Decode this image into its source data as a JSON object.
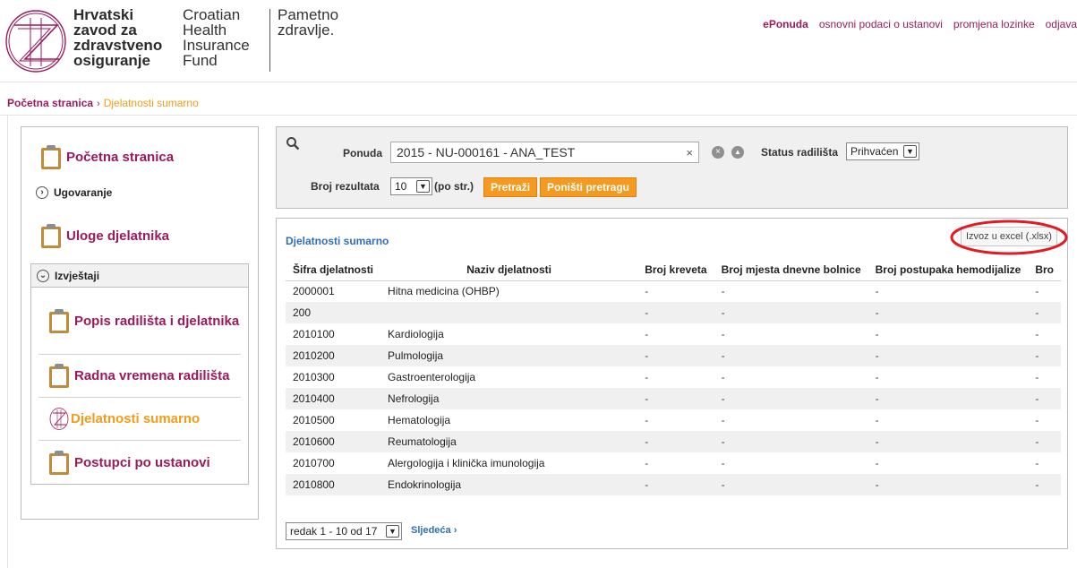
{
  "logo": {
    "hr_line1": "Hrvatski",
    "hr_line2": "zavod za",
    "hr_line3": "zdravstveno",
    "hr_line4": "osiguranje",
    "en_line1": "Croatian",
    "en_line2": "Health",
    "en_line3": "Insurance",
    "en_line4": "Fund",
    "slogan_line1": "Pametno",
    "slogan_line2": "zdravlje."
  },
  "top_nav": {
    "eponuda": "ePonuda",
    "basic_data": "osnovni podaci o ustanovi",
    "change_password": "promjena lozinke",
    "logout": "odjava"
  },
  "breadcrumb": {
    "home": "Početna stranica",
    "separator": "›",
    "current": "Djelatnosti sumarno"
  },
  "sidebar": {
    "home": "Početna stranica",
    "contracting": "Ugovaranje",
    "employee_roles": "Uloge djelatnika",
    "reports": "Izvještaji",
    "report_items": [
      "Popis radilišta i djelatnika",
      "Radna vremena radilišta",
      "Djelatnosti sumarno",
      "Postupci po ustanovi"
    ]
  },
  "search": {
    "ponuda_label": "Ponuda",
    "ponuda_value": "2015 - NU-000161 - ANA_TEST",
    "clear": "×",
    "status_label": "Status radilišta",
    "status_value": "Prihvaćen",
    "results_label": "Broj rezultata",
    "results_value": "10",
    "per_page": "(po str.)",
    "search_button": "Pretraži",
    "reset_button": "Poništi pretragu"
  },
  "results": {
    "title": "Djelatnosti sumarno",
    "export_button": "Izvoz u excel (.xlsx)",
    "columns": [
      "Šifra djelatnosti",
      "Naziv djelatnosti",
      "Broj kreveta",
      "Broj mjesta dnevne bolnice",
      "Broj postupaka hemodijalize",
      "Bro"
    ],
    "rows": [
      [
        "2000001",
        "Hitna medicina (OHBP)",
        "-",
        "-",
        "-",
        "-"
      ],
      [
        "200",
        "",
        "-",
        "-",
        "-",
        "-"
      ],
      [
        "2010100",
        "Kardiologija",
        "-",
        "-",
        "-",
        "-"
      ],
      [
        "2010200",
        "Pulmologija",
        "-",
        "-",
        "-",
        "-"
      ],
      [
        "2010300",
        "Gastroenterologija",
        "-",
        "-",
        "-",
        "-"
      ],
      [
        "2010400",
        "Nefrologija",
        "-",
        "-",
        "-",
        "-"
      ],
      [
        "2010500",
        "Hematologija",
        "-",
        "-",
        "-",
        "-"
      ],
      [
        "2010600",
        "Reumatologija",
        "-",
        "-",
        "-",
        "-"
      ],
      [
        "2010700",
        "Alergologija i klinička imunologija",
        "-",
        "-",
        "-",
        "-"
      ],
      [
        "2010800",
        "Endokrinologija",
        "-",
        "-",
        "-",
        "-"
      ]
    ],
    "pager": "redak 1 - 10 od 17",
    "next": "Sljedeća ›"
  },
  "colors": {
    "brand": "#9b1a5c",
    "accent_orange": "#f39c1a",
    "link_blue": "#2f6db5",
    "highlight_red": "#e21b23"
  }
}
